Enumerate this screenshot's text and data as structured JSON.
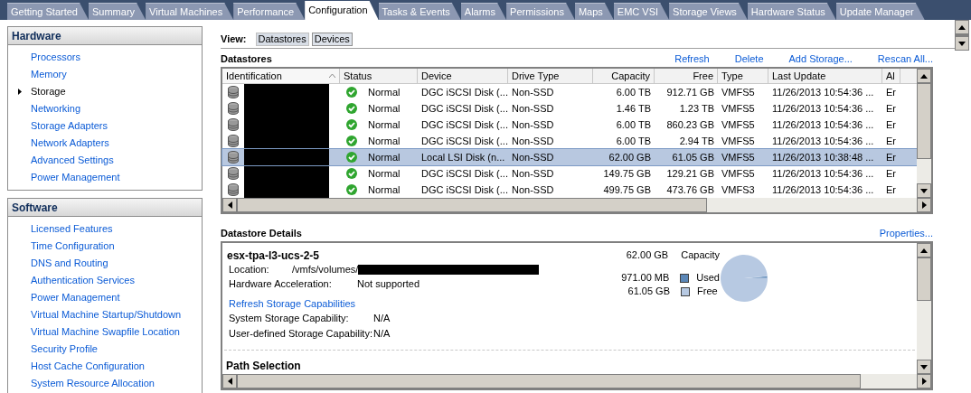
{
  "tabs": [
    {
      "label": "Getting Started",
      "selected": false
    },
    {
      "label": "Summary",
      "selected": false
    },
    {
      "label": "Virtual Machines",
      "selected": false
    },
    {
      "label": "Performance",
      "selected": false
    },
    {
      "label": "Configuration",
      "selected": true
    },
    {
      "label": "Tasks & Events",
      "selected": false
    },
    {
      "label": "Alarms",
      "selected": false
    },
    {
      "label": "Permissions",
      "selected": false
    },
    {
      "label": "Maps",
      "selected": false
    },
    {
      "label": "EMC VSI",
      "selected": false
    },
    {
      "label": "Storage Views",
      "selected": false
    },
    {
      "label": "Hardware Status",
      "selected": false
    },
    {
      "label": "Update Manager",
      "selected": false
    }
  ],
  "sidebar": [
    {
      "title": "Hardware",
      "items": [
        {
          "label": "Processors",
          "selected": false
        },
        {
          "label": "Memory",
          "selected": false
        },
        {
          "label": "Storage",
          "selected": true
        },
        {
          "label": "Networking",
          "selected": false
        },
        {
          "label": "Storage Adapters",
          "selected": false
        },
        {
          "label": "Network Adapters",
          "selected": false
        },
        {
          "label": "Advanced Settings",
          "selected": false
        },
        {
          "label": "Power Management",
          "selected": false
        }
      ]
    },
    {
      "title": "Software",
      "items": [
        {
          "label": "Licensed Features",
          "selected": false
        },
        {
          "label": "Time Configuration",
          "selected": false
        },
        {
          "label": "DNS and Routing",
          "selected": false
        },
        {
          "label": "Authentication Services",
          "selected": false
        },
        {
          "label": "Power Management",
          "selected": false
        },
        {
          "label": "Virtual Machine Startup/Shutdown",
          "selected": false
        },
        {
          "label": "Virtual Machine Swapfile Location",
          "selected": false
        },
        {
          "label": "Security Profile",
          "selected": false
        },
        {
          "label": "Host Cache Configuration",
          "selected": false
        },
        {
          "label": "System Resource Allocation",
          "selected": false
        }
      ]
    }
  ],
  "view": {
    "label": "View:",
    "options": [
      {
        "label": "Datastores",
        "selected": true
      },
      {
        "label": "Devices",
        "selected": false
      }
    ]
  },
  "datastores": {
    "title": "Datastores",
    "actions": [
      "Refresh",
      "Delete",
      "Add Storage...",
      "Rescan All..."
    ],
    "table": {
      "columns": [
        {
          "label": "Identification",
          "sorted": true
        },
        {
          "label": "Status",
          "sorted": false
        },
        {
          "label": "Device",
          "sorted": false
        },
        {
          "label": "Drive Type",
          "sorted": false
        },
        {
          "label": "Capacity",
          "sorted": false
        },
        {
          "label": "Free",
          "sorted": false
        },
        {
          "label": "Type",
          "sorted": false
        },
        {
          "label": "Last Update",
          "sorted": false
        },
        {
          "label": "Al",
          "sorted": false
        }
      ],
      "rows": [
        {
          "selected": false,
          "status": "Normal",
          "device": "DGC iSCSI Disk (...",
          "drive_type": "Non-SSD",
          "capacity": "6.00 TB",
          "free": "912.71 GB",
          "type": "VMFS5",
          "last_update": "11/26/2013 10:54:36 ...",
          "column_9": "Er"
        },
        {
          "selected": false,
          "status": "Normal",
          "device": "DGC iSCSI Disk (...",
          "drive_type": "Non-SSD",
          "capacity": "1.46 TB",
          "free": "1.23 TB",
          "type": "VMFS5",
          "last_update": "11/26/2013 10:54:36 ...",
          "column_9": "Er"
        },
        {
          "selected": false,
          "status": "Normal",
          "device": "DGC iSCSI Disk (...",
          "drive_type": "Non-SSD",
          "capacity": "6.00 TB",
          "free": "860.23 GB",
          "type": "VMFS5",
          "last_update": "11/26/2013 10:54:36 ...",
          "column_9": "Er"
        },
        {
          "selected": false,
          "status": "Normal",
          "device": "DGC iSCSI Disk (...",
          "drive_type": "Non-SSD",
          "capacity": "6.00 TB",
          "free": "2.94 TB",
          "type": "VMFS5",
          "last_update": "11/26/2013 10:54:36 ...",
          "column_9": "Er"
        },
        {
          "selected": true,
          "status": "Normal",
          "device": "Local LSI Disk (n...",
          "drive_type": "Non-SSD",
          "capacity": "62.00 GB",
          "free": "61.05 GB",
          "type": "VMFS5",
          "last_update": "11/26/2013 10:38:48 ...",
          "column_9": "Er"
        },
        {
          "selected": false,
          "status": "Normal",
          "device": "DGC iSCSI Disk (...",
          "drive_type": "Non-SSD",
          "capacity": "149.75 GB",
          "free": "129.21 GB",
          "type": "VMFS5",
          "last_update": "11/26/2013 10:54:36 ...",
          "column_9": "Er"
        },
        {
          "selected": false,
          "status": "Normal",
          "device": "DGC iSCSI Disk (...",
          "drive_type": "Non-SSD",
          "capacity": "499.75 GB",
          "free": "473.76 GB",
          "type": "VMFS3",
          "last_update": "11/26/2013 10:54:36 ...",
          "column_9": "Er"
        }
      ]
    }
  },
  "details": {
    "title": "Datastore Details",
    "action": "Properties...",
    "name": "esx-tpa-l3-ucs-2-5",
    "fields": [
      {
        "label": "Location:",
        "value": "/vmfs/volumes/"
      },
      {
        "label": "Hardware Acceleration:",
        "value": "Not supported"
      }
    ],
    "link": "Refresh Storage Capabilities",
    "capabilities": [
      {
        "label": "System Storage Capability:",
        "value": "N/A"
      },
      {
        "label": "User-defined Storage Capability:",
        "value": "N/A"
      }
    ],
    "capacity": {
      "amount": "62.00 GB",
      "label": "Capacity"
    },
    "legend": [
      {
        "amount": "971.00 MB",
        "color": "#5b87b7"
      },
      {
        "amount": "61.05 GB",
        "color": "#b7c9e2"
      }
    ],
    "chart_data": {
      "type": "pie",
      "categories": [
        "Used",
        "Free"
      ],
      "values": [
        1.57,
        98.43
      ]
    },
    "path_selection": "Path Selection"
  }
}
